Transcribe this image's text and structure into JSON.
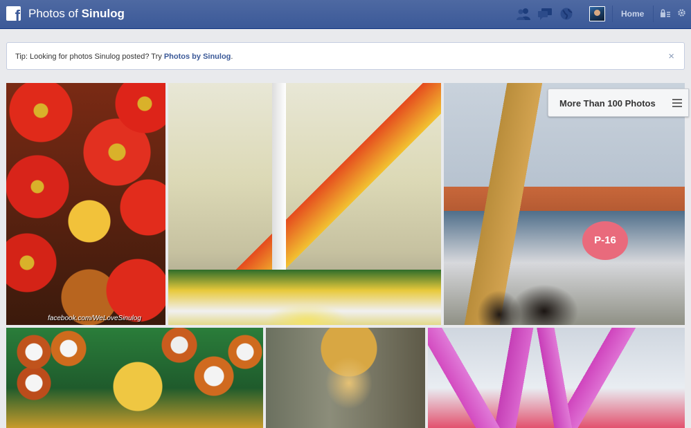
{
  "header": {
    "title_prefix": "Photos of",
    "title_name": "Sinulog",
    "logo_letter": "f",
    "home_label": "Home",
    "icons": [
      "friend-requests-icon",
      "messages-icon",
      "notifications-globe-icon",
      "privacy-lock-icon",
      "settings-gear-icon"
    ]
  },
  "tip": {
    "text": "Tip: Looking for photos Sinulog posted? Try ",
    "link": "Photos by Sinulog",
    "suffix": ".",
    "close": "×"
  },
  "album": {
    "badge_label": "More Than 100 Photos"
  },
  "photos": [
    {
      "watermark": "facebook.com/WeLoveSinulog"
    },
    {},
    {
      "tag": "P-16"
    },
    {},
    {},
    {}
  ],
  "colors": {
    "brand_blue": "#3b5998",
    "page_bg": "#e9eaed",
    "link_blue": "#3b5998"
  }
}
